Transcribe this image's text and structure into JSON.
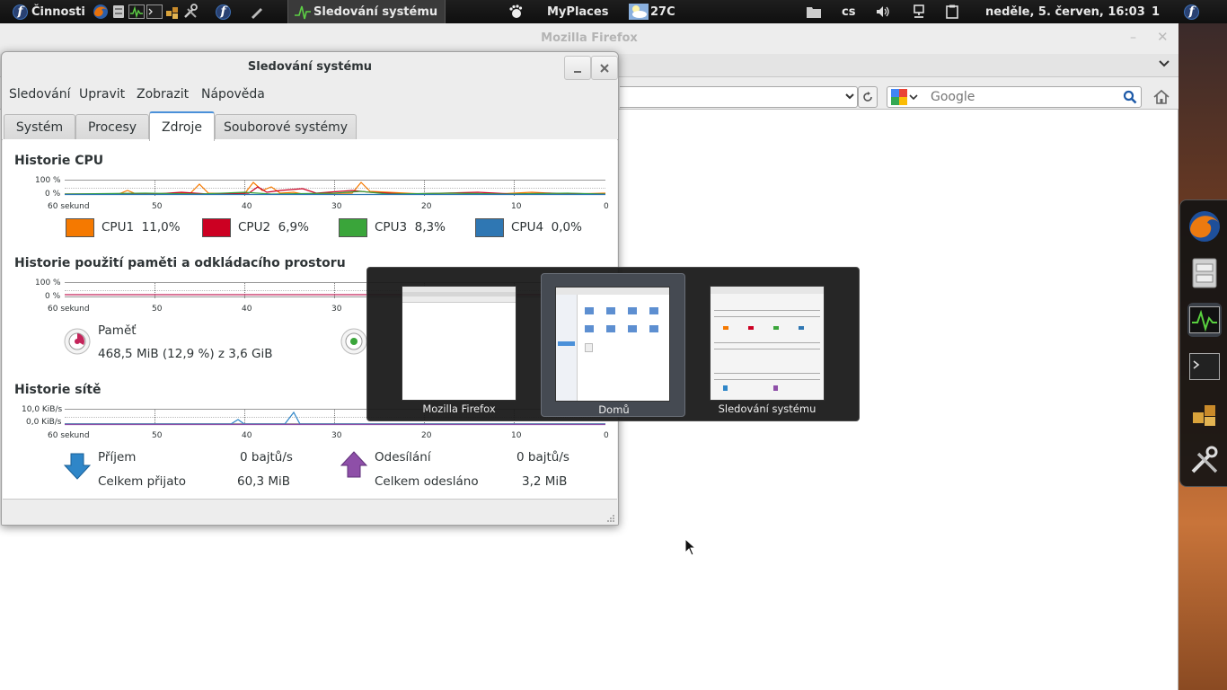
{
  "top_panel": {
    "activities": "Činnosti",
    "active_task": "Sledování systému",
    "myplaces": "MyPlaces",
    "weather": "27C",
    "language": "cs",
    "datetime": "neděle, 5. červen, 16:03",
    "workspace": "1"
  },
  "firefox": {
    "title": "Mozilla Firefox",
    "search_placeholder": "Google"
  },
  "system_monitor": {
    "title": "Sledování systému",
    "menu": [
      "Sledování",
      "Upravit",
      "Zobrazit",
      "Nápověda"
    ],
    "tabs": [
      "Systém",
      "Procesy",
      "Zdroje",
      "Souborové systémy"
    ],
    "active_tab": "Zdroje",
    "axis_ticks": [
      "60 sekund",
      "50",
      "40",
      "30",
      "20",
      "10",
      "0"
    ],
    "cpu": {
      "title": "Historie CPU",
      "y_ticks": [
        "100 %",
        "0 %"
      ],
      "legend": [
        {
          "name": "CPU1",
          "value": "11,0%",
          "color": "#f57900"
        },
        {
          "name": "CPU2",
          "value": "6,9%",
          "color": "#cc0022"
        },
        {
          "name": "CPU3",
          "value": "8,3%",
          "color": "#3aa53a"
        },
        {
          "name": "CPU4",
          "value": "0,0%",
          "color": "#2f77b3"
        }
      ]
    },
    "memory": {
      "title": "Historie použití paměti a odkládacího prostoru",
      "y_ticks": [
        "100 %",
        "0 %"
      ],
      "label": "Paměť",
      "value": "468,5 MiB (12,9 %) z 3,6 GiB"
    },
    "network": {
      "title": "Historie sítě",
      "y_ticks": [
        "10,0 KiB/s",
        "0,0 KiB/s"
      ],
      "receive_label": "Příjem",
      "receive_rate": "0 bajtů/s",
      "total_received_label": "Celkem přijato",
      "total_received": "60,3 MiB",
      "send_label": "Odesílání",
      "send_rate": "0 bajtů/s",
      "total_sent_label": "Celkem odesláno",
      "total_sent": "3,2 MiB"
    }
  },
  "switcher": {
    "items": [
      {
        "label": "Mozilla Firefox"
      },
      {
        "label": "Domů"
      },
      {
        "label": "Sledování systému"
      }
    ],
    "selected": "Domů"
  },
  "colors": {
    "accent": "#4a90d9",
    "panel": "#141414",
    "mem_color": "#c4245a",
    "rx_color": "#2f86c8",
    "tx_color": "#8e4fa8"
  }
}
